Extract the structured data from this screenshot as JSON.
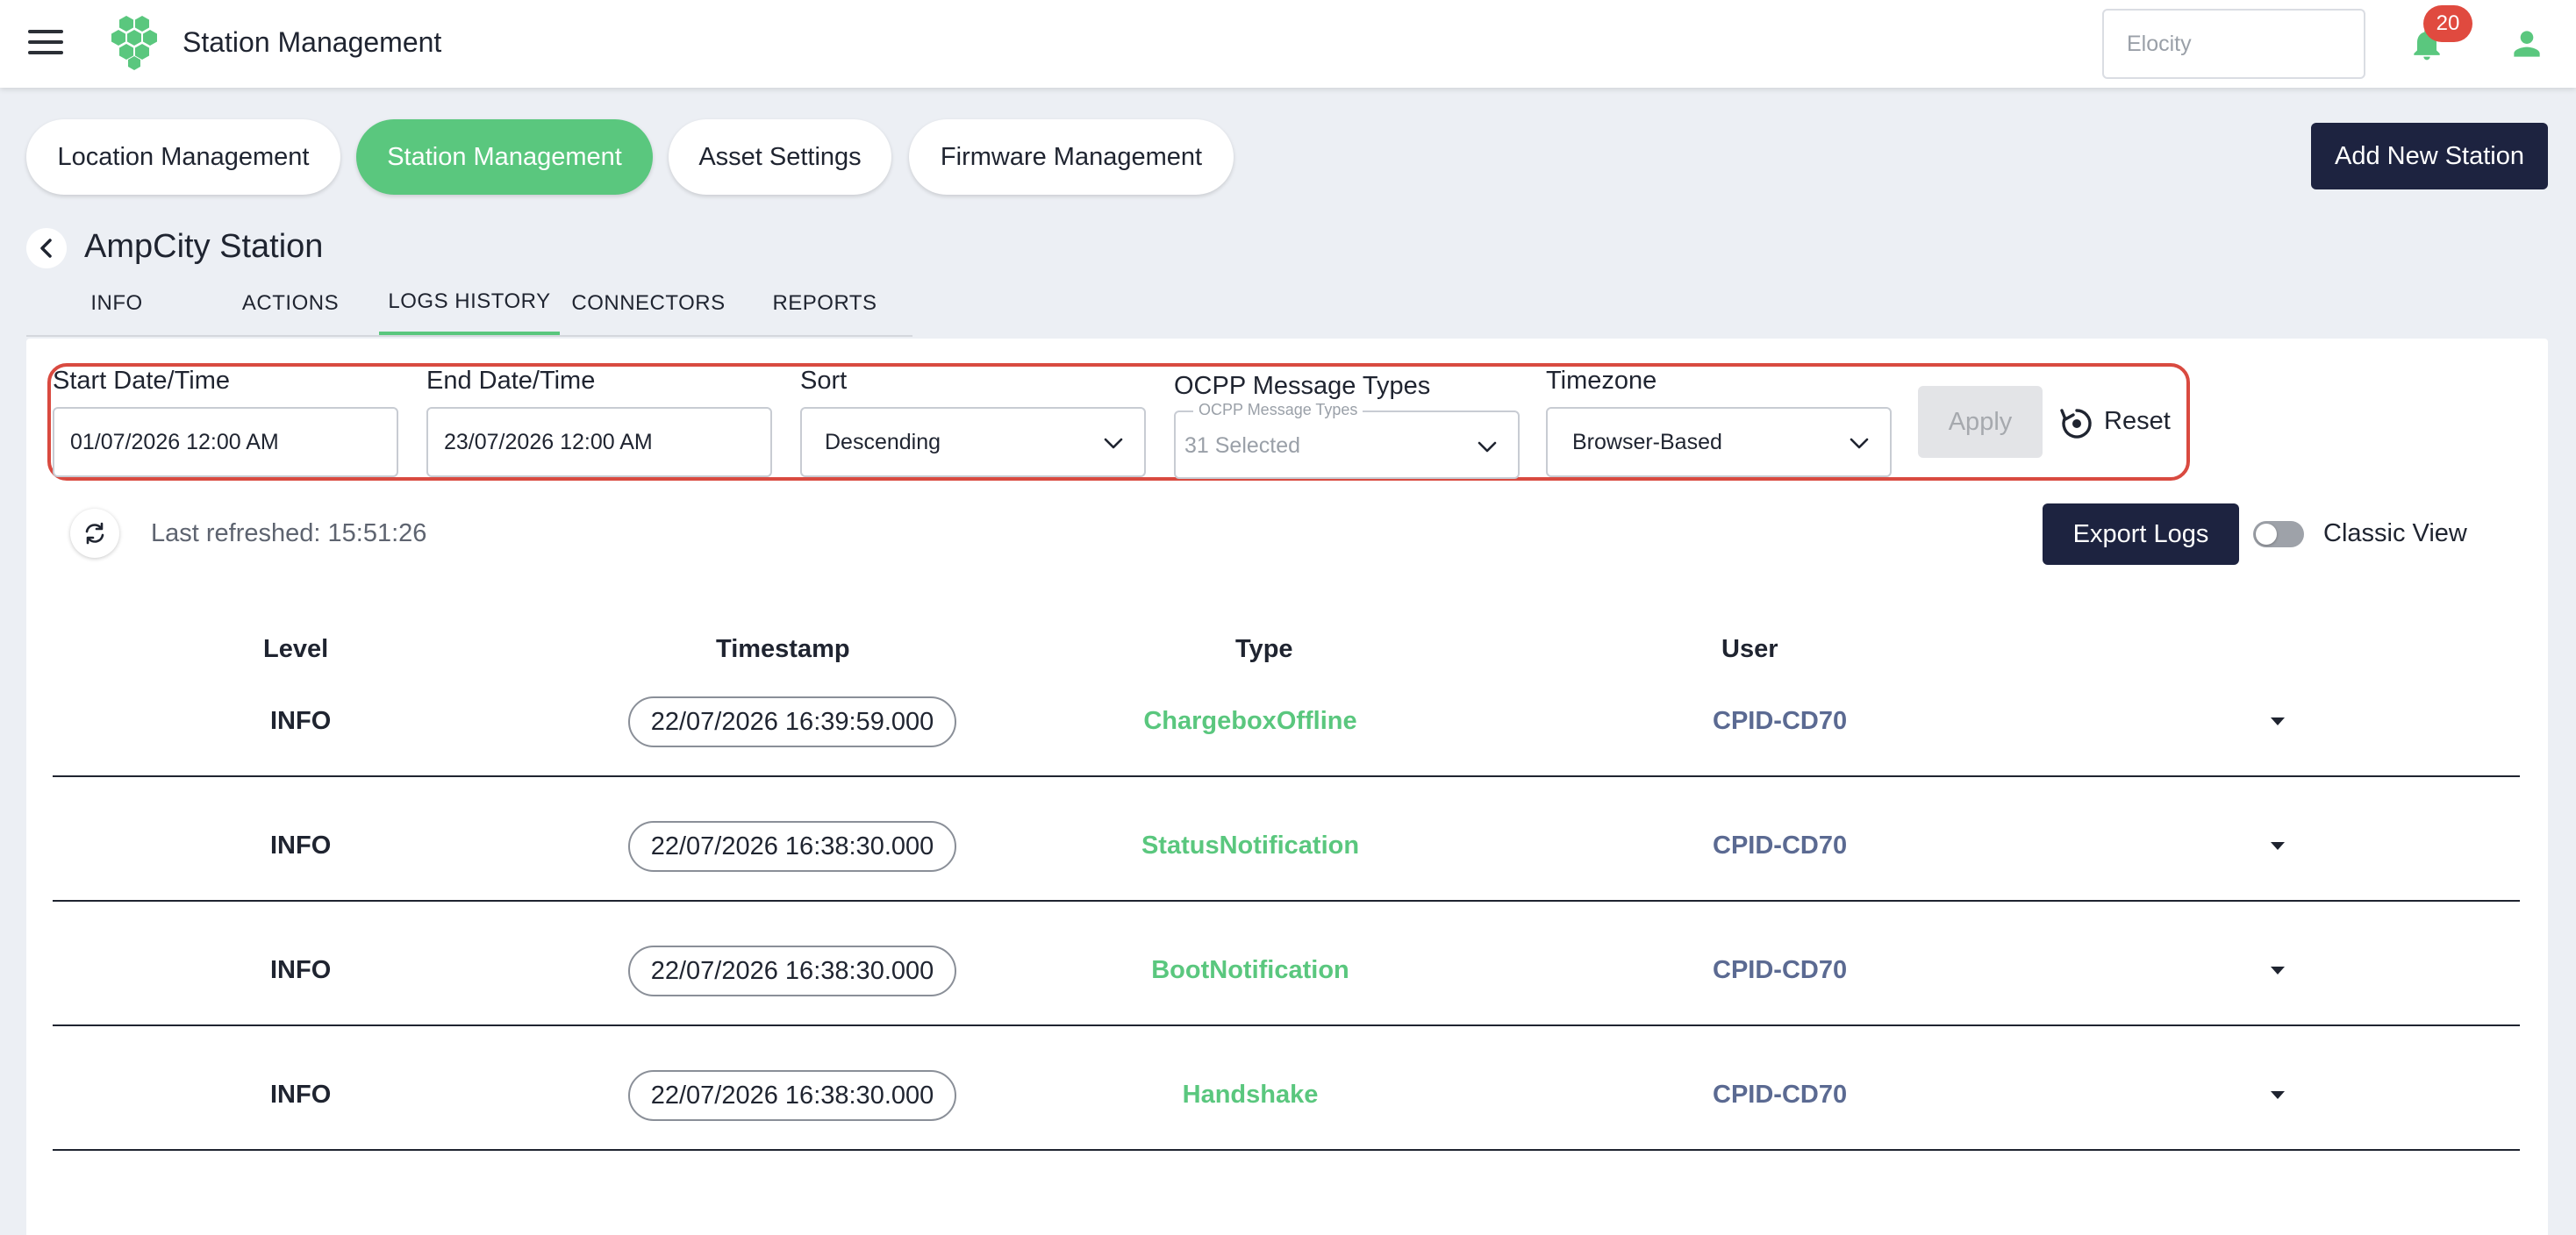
{
  "header": {
    "title": "Station Management",
    "org_placeholder": "Elocity",
    "notification_count": "20"
  },
  "nav": {
    "pills": [
      {
        "label": "Location Management"
      },
      {
        "label": "Station Management",
        "active": true
      },
      {
        "label": "Asset Settings"
      },
      {
        "label": "Firmware Management"
      }
    ],
    "add_button": "Add New Station"
  },
  "station": {
    "name": "AmpCity Station",
    "tabs": [
      {
        "label": "INFO"
      },
      {
        "label": "ACTIONS"
      },
      {
        "label": "LOGS HISTORY",
        "active": true
      },
      {
        "label": "CONNECTORS"
      },
      {
        "label": "REPORTS"
      }
    ]
  },
  "filters": {
    "start": {
      "label": "Start Date/Time",
      "value": "01/07/2026 12:00 AM"
    },
    "end": {
      "label": "End Date/Time",
      "value": "23/07/2026 12:00 AM"
    },
    "sort": {
      "label": "Sort",
      "value": "Descending"
    },
    "message_types": {
      "label": "OCPP Message Types",
      "floating_label": "OCPP Message Types",
      "value": "31 Selected"
    },
    "timezone": {
      "label": "Timezone",
      "value": "Browser-Based"
    },
    "apply": "Apply",
    "reset": "Reset"
  },
  "toolbar": {
    "refreshed": "Last refreshed: 15:51:26",
    "export": "Export Logs",
    "classic_view": "Classic View",
    "classic_view_on": false
  },
  "table": {
    "columns": [
      "Level",
      "Timestamp",
      "Type",
      "User"
    ],
    "rows": [
      {
        "level": "INFO",
        "timestamp": "22/07/2026 16:39:59.000",
        "type": "ChargeboxOffline",
        "user": "CPID-CD70"
      },
      {
        "level": "INFO",
        "timestamp": "22/07/2026 16:38:30.000",
        "type": "StatusNotification",
        "user": "CPID-CD70"
      },
      {
        "level": "INFO",
        "timestamp": "22/07/2026 16:38:30.000",
        "type": "BootNotification",
        "user": "CPID-CD70"
      },
      {
        "level": "INFO",
        "timestamp": "22/07/2026 16:38:30.000",
        "type": "Handshake",
        "user": "CPID-CD70"
      }
    ]
  },
  "colors": {
    "brand_green": "#5ac77e",
    "navy": "#1d2340",
    "alert_red": "#e04a3f",
    "user_link": "#5b6a92"
  },
  "icons": {
    "menu": "hamburger-icon",
    "logo": "hexagon-logo-icon",
    "notifications": "bell-icon",
    "profile": "user-icon",
    "back": "chevron-left-icon",
    "dropdown": "chevron-down-icon",
    "reset": "reset-icon",
    "refresh": "refresh-icon",
    "expand": "caret-down-icon"
  }
}
